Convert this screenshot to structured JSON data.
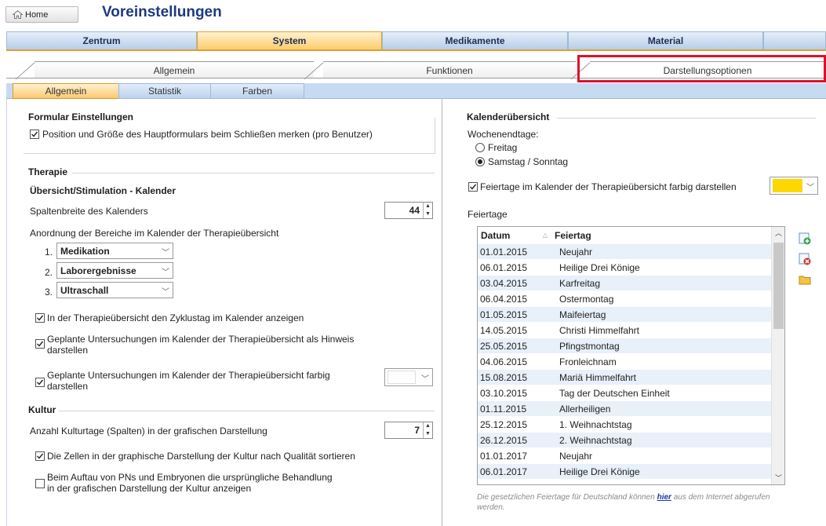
{
  "header": {
    "home_label": "Home",
    "title": "Voreinstellungen"
  },
  "main_tabs": [
    "Zentrum",
    "System",
    "Medikamente",
    "Material"
  ],
  "sub_tabs_1": [
    "Allgemein",
    "Funktionen",
    "Darstellungsoptionen"
  ],
  "sub_tabs_2": [
    "Allgemein",
    "Statistik",
    "Farben"
  ],
  "left": {
    "formular_title": "Formular Einstellungen",
    "formular_cb": "Position und Größe des Hauptformulars beim Schließen merken (pro Benutzer)",
    "therapie_title": "Therapie",
    "kalender_sub": "Übersicht/Stimulation - Kalender",
    "spaltenbreite_label": "Spaltenbreite des Kalenders",
    "spaltenbreite_value": "44",
    "anordnung_label": "Anordnung der Bereiche im Kalender der Therapieübersicht",
    "order": [
      {
        "num": "1.",
        "value": "Medikation"
      },
      {
        "num": "2.",
        "value": "Laborergebnisse"
      },
      {
        "num": "3.",
        "value": "Ultraschall"
      }
    ],
    "cb_zyklustag": "In der Therapieübersicht den Zyklustag im Kalender anzeigen",
    "cb_hinweis_1": "Geplante Untersuchungen im Kalender der Therapieübersicht als Hinweis",
    "cb_hinweis_2": "darstellen",
    "cb_farbig_1": "Geplante Untersuchungen im Kalender der Therapieübersicht farbig",
    "cb_farbig_2": "darstellen",
    "kultur_title": "Kultur",
    "kulturtage_label": "Anzahl Kulturtage (Spalten) in der grafischen Darstellung",
    "kulturtage_value": "7",
    "cb_sortieren": "Die Zellen in der graphische Darstellung der Kultur nach Qualität sortieren",
    "cb_aufbau_1": "Beim Auftau von PNs und Embryonen die ursprüngliche Behandlung",
    "cb_aufbau_2": "in der grafischen Darstellung der Kultur anzeigen"
  },
  "right": {
    "kal_title": "Kalenderübersicht",
    "wochenendtage_label": "Wochenendtage:",
    "radio_freitag": "Freitag",
    "radio_samstag": "Samstag / Sonntag",
    "cb_feiertage": "Feiertage im Kalender der Therapieübersicht farbig darstellen",
    "feiertage_label": "Feiertage",
    "col_datum": "Datum",
    "col_feiertag": "Feiertag",
    "rows": [
      {
        "d": "01.01.2015",
        "f": "Neujahr"
      },
      {
        "d": "06.01.2015",
        "f": "Heilige Drei Könige"
      },
      {
        "d": "03.04.2015",
        "f": "Karfreitag"
      },
      {
        "d": "06.04.2015",
        "f": "Ostermontag"
      },
      {
        "d": "01.05.2015",
        "f": "Maifeiertag"
      },
      {
        "d": "14.05.2015",
        "f": "Christi Himmelfahrt"
      },
      {
        "d": "25.05.2015",
        "f": "Pfingstmontag"
      },
      {
        "d": "04.06.2015",
        "f": "Fronleichnam"
      },
      {
        "d": "15.08.2015",
        "f": "Mariä Himmelfahrt"
      },
      {
        "d": "03.10.2015",
        "f": "Tag der Deutschen Einheit"
      },
      {
        "d": "01.11.2015",
        "f": "Allerheiligen"
      },
      {
        "d": "25.12.2015",
        "f": "1. Weihnachtstag"
      },
      {
        "d": "26.12.2015",
        "f": "2. Weihnachtstag"
      },
      {
        "d": "01.01.2017",
        "f": "Neujahr"
      },
      {
        "d": "06.01.2017",
        "f": "Heilige Drei Könige"
      }
    ],
    "note_before": "Die gesetzlichen Feiertage für Deutschland können ",
    "note_link": "hier",
    "note_after": " aus dem Internet abgerufen werden."
  },
  "colors": {
    "accent_orange": "#fbcd6c",
    "feiertage_color": "#ffd700",
    "highlight_red": "#e0102a"
  }
}
